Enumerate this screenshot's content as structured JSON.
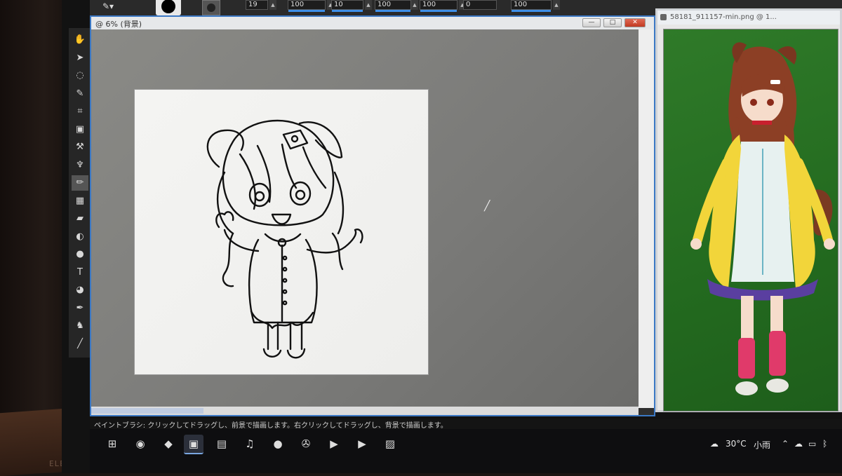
{
  "options_bar": {
    "fields": [
      "19",
      "100",
      "10",
      "100",
      "100",
      "0",
      "100"
    ]
  },
  "document_window": {
    "title": "6% (背景)",
    "buttons": {
      "minimize": "—",
      "maximize": "□",
      "close": "✕"
    }
  },
  "reference_window": {
    "title": "58181_911157-min.png @ 1..."
  },
  "tools": [
    {
      "name": "hand-tool",
      "glyph": "✋"
    },
    {
      "name": "select-tool",
      "glyph": "➤"
    },
    {
      "name": "lasso-tool",
      "glyph": "◌"
    },
    {
      "name": "eyedropper-tool",
      "glyph": "✎"
    },
    {
      "name": "crop-tool",
      "glyph": "⌗"
    },
    {
      "name": "transform-tool",
      "glyph": "▣"
    },
    {
      "name": "clone-tool",
      "glyph": "⚒"
    },
    {
      "name": "fix-tool",
      "glyph": "♆"
    },
    {
      "name": "brush-tool",
      "glyph": "✏"
    },
    {
      "name": "gradient-tool",
      "glyph": "▦"
    },
    {
      "name": "eraser-tool",
      "glyph": "▰"
    },
    {
      "name": "dodge-tool",
      "glyph": "◐"
    },
    {
      "name": "smudge-tool",
      "glyph": "●"
    },
    {
      "name": "text-tool",
      "glyph": "T"
    },
    {
      "name": "shape-tool",
      "glyph": "◕"
    },
    {
      "name": "pen-tool",
      "glyph": "✒"
    },
    {
      "name": "picture-tube-tool",
      "glyph": "♞"
    },
    {
      "name": "warp-tool",
      "glyph": "╱"
    }
  ],
  "status_text": "ペイントブラシ: クリックしてドラッグし、前景で描画します。右クリックしてドラッグし、背景で描画します。",
  "desk_label": "ELE",
  "taskbar": {
    "weather_temp": "30°C",
    "weather_desc": "小雨"
  },
  "colors": {
    "accent": "#3b78c4",
    "workspace": "#7c7c7a",
    "reference_bg": "#2a7424",
    "coat_yellow": "#f2d53a",
    "leggings_pink": "#e03a6a"
  }
}
